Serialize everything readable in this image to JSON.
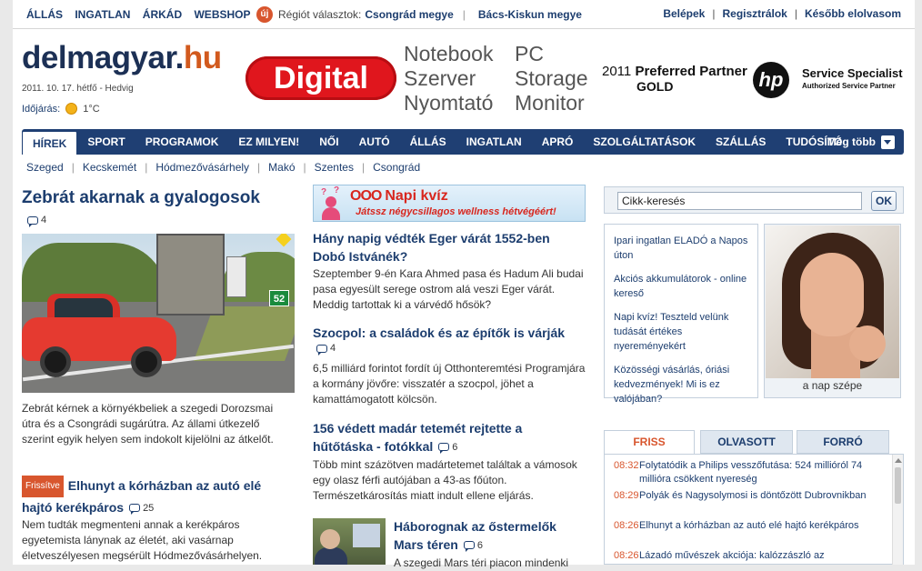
{
  "topnav": [
    "ÁLLÁS",
    "INGATLAN",
    "ÁRKÁD",
    "WEBSHOP"
  ],
  "region": {
    "badge": "új",
    "prompt": "Régiót választok:",
    "options": [
      "Csongrád megye",
      "Bács-Kiskun megye"
    ]
  },
  "userlinks": [
    "Belépek",
    "Regisztrálok",
    "Később elolvasom"
  ],
  "logo": {
    "main": "delmagyar.",
    "tld": "hu"
  },
  "date": "2011. 10. 17. hétfő - Hedvig",
  "weather": {
    "label": "Időjárás:",
    "temp": "1°C",
    "icon": "sun-icon"
  },
  "banner": {
    "brand": "Digital",
    "col1": [
      "Notebook",
      "Szerver",
      "Nyomtató"
    ],
    "col2": [
      "PC",
      "Storage",
      "Monitor"
    ],
    "partner_year": "2011",
    "partner_text": "Preferred Partner",
    "partner_level": "GOLD",
    "hp": "hp",
    "service": "Service Specialist",
    "service_sub": "Authorized Service Partner"
  },
  "mainnav": {
    "items": [
      "HÍREK",
      "SPORT",
      "PROGRAMOK",
      "EZ MILYEN!",
      "NŐI",
      "AUTÓ",
      "ÁLLÁS",
      "INGATLAN",
      "APRÓ",
      "SZOLGÁLTATÁSOK",
      "SZÁLLÁS",
      "TUDÓSÍTÓ"
    ],
    "active": "HÍREK",
    "more": "Még több"
  },
  "subnav": [
    "Szeged",
    "Kecskemét",
    "Hódmezővásárhely",
    "Makó",
    "Szentes",
    "Csongrád"
  ],
  "lead": {
    "title": "Zebrát akarnak a gyalogosok",
    "comments": "4",
    "text": "Zebrát kérnek a környékbeliek a szegedi Dorozsmai útra és a Csongrádi sugárútra. Az állami útkezelő szerint egyik helyen sem indokolt kijelölni az átkelőt.",
    "sign": "52"
  },
  "story2": {
    "tag": "Frissítve",
    "title": "Elhunyt a kórházban az autó elé hajtó kerékpáros",
    "comments": "25",
    "text": "Nem tudták megmenteni annak a kerékpáros egyetemista lánynak az életét, aki vasárnap életveszélyesen megsérült Hódmezővásárhelyen."
  },
  "quiz": {
    "circles": "OOO",
    "title": "Napi kvíz",
    "subtitle": "Játssz négycsillagos wellness hétvégéért!"
  },
  "middle": [
    {
      "title": "Hány napig védték Eger várát 1552-ben Dobó Istvánék?",
      "comments": "",
      "text": "Szeptember 9-én Kara Ahmed pasa és Hadum Ali budai pasa egyesült serege ostrom alá veszi Eger várát. Meddig tartottak ki a várvédő hősök?"
    },
    {
      "title": "Szocpol: a családok és az építők is várják",
      "comments": "4",
      "text": "6,5 milliárd forintot fordít új Otthonteremtési Programjára a kormány jövőre: visszatér a szocpol, jöhet a kamattámogatott kölcsön."
    },
    {
      "title": "156 védett madár tetemét rejtette a hűtőtáska - fotókkal",
      "comments": "6",
      "text": "Több mint százötven madártetemet találtak a vámosok egy olasz férfi autójában a 43-as főúton. Természetkárosítás miatt indult ellene eljárás."
    },
    {
      "title": "Háborognak az őstermelők Mars téren",
      "comments": "6",
      "text": "A szegedi Mars téri piacon mindenki"
    }
  ],
  "search": {
    "value": "Cikk-keresés",
    "button": "OK"
  },
  "promos": [
    "Ipari ingatlan ELADÓ a Napos úton",
    "Akciós akkumulátorok - online kereső",
    "Napi kvíz! Teszteld velünk tudását értékes nyereményekért",
    "Közösségi vásárlás, óriási kedvezmények! Mi is ez valójában?"
  ],
  "beauty": {
    "caption": "a nap szépe"
  },
  "tabs": {
    "items": [
      "FRISS",
      "OLVASOTT",
      "FORRÓ"
    ],
    "active": "FRISS"
  },
  "feed": [
    {
      "time": "08:32",
      "text": "Folytatódik a Philips vesszőfutása: 524 millióról 74 millióra csökkent nyereség"
    },
    {
      "time": "08:29",
      "text": "Polyák és Nagysolymosi is döntőzött Dubrovnikban"
    },
    {
      "time": "08:26",
      "text": "Elhunyt a kórházban az autó elé hajtó kerékpáros"
    },
    {
      "time": "08:26",
      "text": "Lázadó művészek akciója: kalózzászló az"
    }
  ]
}
